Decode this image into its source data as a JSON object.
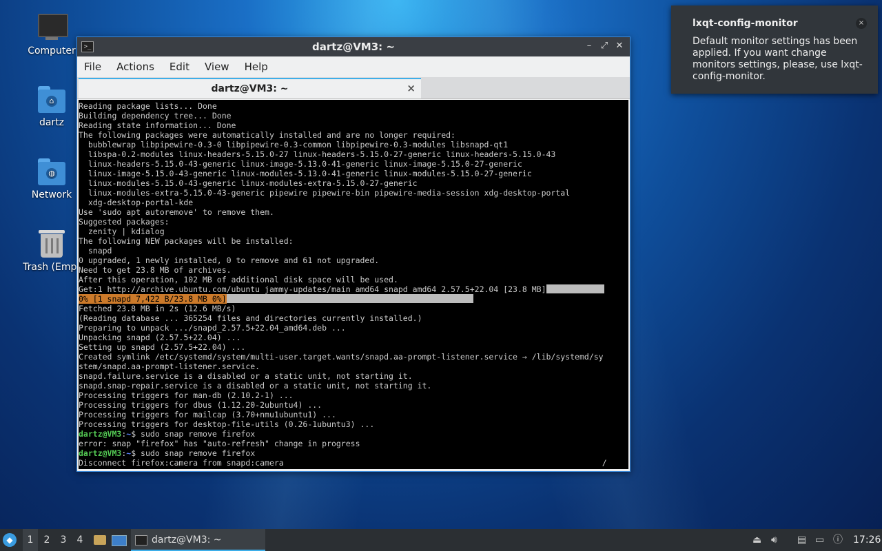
{
  "desktop": {
    "icons": [
      {
        "label": "Computer"
      },
      {
        "label": "dartz"
      },
      {
        "label": "Network"
      },
      {
        "label": "Trash (Empt"
      }
    ]
  },
  "window": {
    "title": "dartz@VM3: ~",
    "menu": [
      "File",
      "Actions",
      "Edit",
      "View",
      "Help"
    ],
    "tab": {
      "label": "dartz@VM3: ~",
      "close": "×"
    },
    "buttons": {
      "minimize": "–",
      "maximize": "⤢",
      "close": "✕"
    }
  },
  "terminal": {
    "lines": [
      "Reading package lists... Done",
      "Building dependency tree... Done",
      "Reading state information... Done",
      "The following packages were automatically installed and are no longer required:",
      "  bubblewrap libpipewire-0.3-0 libpipewire-0.3-common libpipewire-0.3-modules libsnapd-qt1",
      "  libspa-0.2-modules linux-headers-5.15.0-27 linux-headers-5.15.0-27-generic linux-headers-5.15.0-43",
      "  linux-headers-5.15.0-43-generic linux-image-5.13.0-41-generic linux-image-5.15.0-27-generic",
      "  linux-image-5.15.0-43-generic linux-modules-5.13.0-41-generic linux-modules-5.15.0-27-generic",
      "  linux-modules-5.15.0-43-generic linux-modules-extra-5.15.0-27-generic",
      "  linux-modules-extra-5.15.0-43-generic pipewire pipewire-bin pipewire-media-session xdg-desktop-portal",
      "  xdg-desktop-portal-kde",
      "Use 'sudo apt autoremove' to remove them.",
      "Suggested packages:",
      "  zenity | kdialog",
      "The following NEW packages will be installed:",
      "  snapd",
      "0 upgraded, 1 newly installed, 0 to remove and 61 not upgraded.",
      "Need to get 23.8 MB of archives.",
      "After this operation, 102 MB of additional disk space will be used."
    ],
    "get_line": "Get:1 http://archive.ubuntu.com/ubuntu jammy-updates/main amd64 snapd amd64 2.57.5+22.04 [23.8 MB]",
    "progress_line": "0% [1 snapd 7,422 B/23.8 MB 0%]",
    "lines2": [
      "Fetched 23.8 MB in 2s (12.6 MB/s)",
      "(Reading database ... 365254 files and directories currently installed.)",
      "Preparing to unpack .../snapd_2.57.5+22.04_amd64.deb ...",
      "Unpacking snapd (2.57.5+22.04) ...",
      "Setting up snapd (2.57.5+22.04) ...",
      "Created symlink /etc/systemd/system/multi-user.target.wants/snapd.aa-prompt-listener.service → /lib/systemd/sy",
      "stem/snapd.aa-prompt-listener.service.",
      "snapd.failure.service is a disabled or a static unit, not starting it.",
      "snapd.snap-repair.service is a disabled or a static unit, not starting it.",
      "Processing triggers for man-db (2.10.2-1) ...",
      "Processing triggers for dbus (1.12.20-2ubuntu4) ...",
      "Processing triggers for mailcap (3.70+nmu1ubuntu1) ...",
      "Processing triggers for desktop-file-utils (0.26-1ubuntu3) ..."
    ],
    "prompt_user": "dartz@VM3",
    "prompt_sep": ":",
    "prompt_path": "~",
    "prompt_symbol": "$",
    "cmd1": " sudo snap remove firefox",
    "error_line": "error: snap \"firefox\" has \"auto-refresh\" change in progress",
    "cmd2": " sudo snap remove firefox",
    "last_line": "Disconnect firefox:camera from snapd:camera",
    "spinner": "/"
  },
  "notification": {
    "title": "lxqt-config-monitor",
    "body": "Default monitor settings has been applied. If you want change monitors settings, please, use lxqt-config-monitor.",
    "close": "×"
  },
  "taskbar": {
    "workspaces": [
      "1",
      "2",
      "3",
      "4"
    ],
    "task_label": "dartz@VM3: ~",
    "clock": "17:26"
  }
}
